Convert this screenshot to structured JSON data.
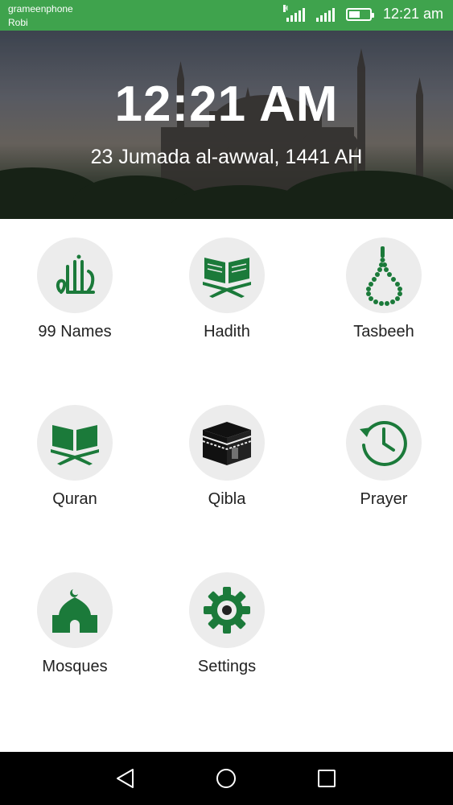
{
  "status_bar": {
    "carrier_primary": "grameenphone",
    "carrier_secondary": "Robi",
    "time": "12:21 am",
    "battery_level": 0.55,
    "icons": [
      "signal-h-icon",
      "signal-icon",
      "battery-icon"
    ],
    "color": "#3fa34d"
  },
  "header": {
    "time": "12:21 AM",
    "hijri_date": "23 Jumada al-awwal, 1441 AH"
  },
  "menu": {
    "items": [
      {
        "label": "99 Names",
        "icon": "allah-calligraphy-icon"
      },
      {
        "label": "Hadith",
        "icon": "book-stand-icon"
      },
      {
        "label": "Tasbeeh",
        "icon": "prayer-beads-icon"
      },
      {
        "label": "Quran",
        "icon": "quran-icon"
      },
      {
        "label": "Qibla",
        "icon": "kaaba-icon"
      },
      {
        "label": "Prayer",
        "icon": "clock-history-icon"
      },
      {
        "label": "Mosques",
        "icon": "mosque-icon"
      },
      {
        "label": "Settings",
        "icon": "gear-icon"
      }
    ],
    "icon_color": "#1b7a3a",
    "icon_bg": "#ececec"
  },
  "nav_bar": {
    "buttons": [
      "back-icon",
      "home-icon",
      "recents-icon"
    ]
  }
}
